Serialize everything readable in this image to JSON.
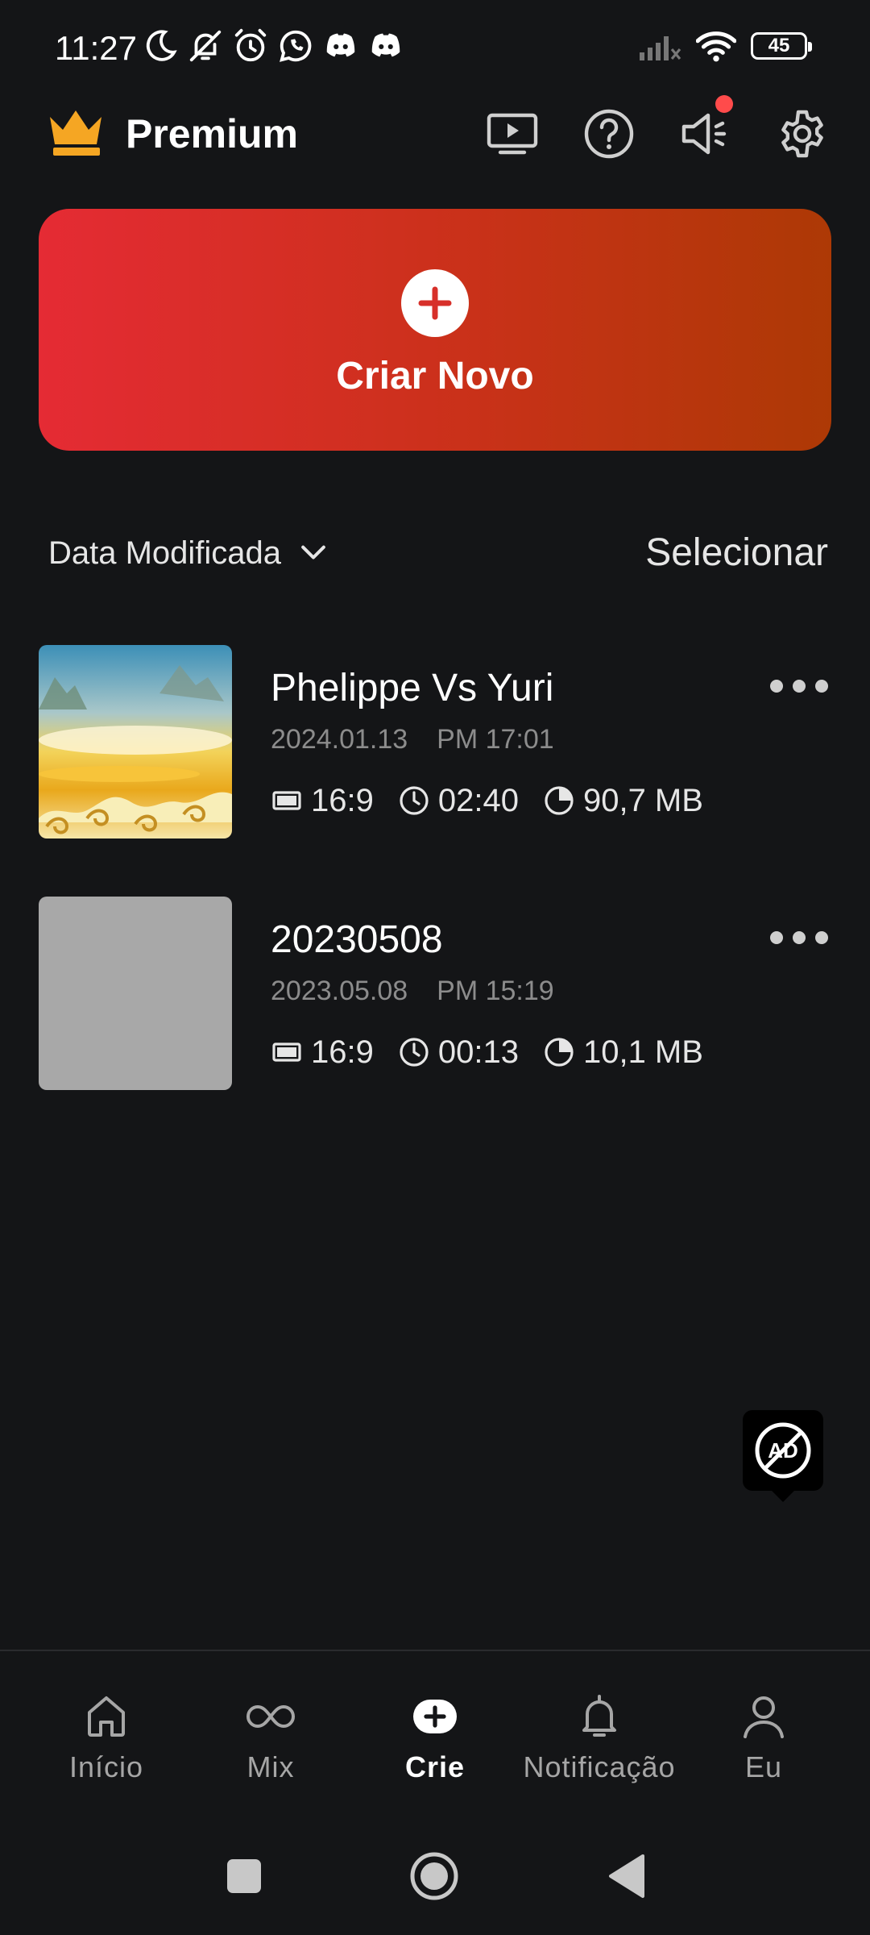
{
  "status_bar": {
    "time": "11:27",
    "battery": "45",
    "icons_left": [
      "moon-icon",
      "bell-off-icon",
      "alarm-icon",
      "whatsapp-icon",
      "discord-icon",
      "discord-icon"
    ],
    "icons_right": [
      "signal-icon",
      "wifi-icon",
      "battery-icon"
    ]
  },
  "header": {
    "title": "Premium",
    "icons": [
      "play-screen-icon",
      "help-icon",
      "megaphone-icon",
      "gear-icon"
    ]
  },
  "create": {
    "label": "Criar Novo"
  },
  "sort": {
    "label": "Data Modificada",
    "select_label": "Selecionar"
  },
  "projects": [
    {
      "title": "Phelippe Vs Yuri",
      "date": "2024.01.13",
      "time": "PM 17:01",
      "ratio": "16:9",
      "duration": "02:40",
      "size": "90,7 MB"
    },
    {
      "title": "20230508",
      "date": "2023.05.08",
      "time": "PM 15:19",
      "ratio": "16:9",
      "duration": "00:13",
      "size": "10,1 MB"
    }
  ],
  "ad_badge": {
    "label": "AD"
  },
  "bottom_nav": {
    "items": [
      {
        "label": "Início",
        "icon": "home-icon",
        "active": false
      },
      {
        "label": "Mix",
        "icon": "infinity-icon",
        "active": false
      },
      {
        "label": "Crie",
        "icon": "plus-icon",
        "active": true
      },
      {
        "label": "Notificação",
        "icon": "bell-icon",
        "active": false
      },
      {
        "label": "Eu",
        "icon": "person-icon",
        "active": false
      }
    ]
  },
  "colors": {
    "background": "#141517",
    "create_gradient_start": "#e52b34",
    "create_gradient_end": "#ad3905",
    "crown": "#f5a623",
    "notification_dot": "#ff4b4b"
  }
}
